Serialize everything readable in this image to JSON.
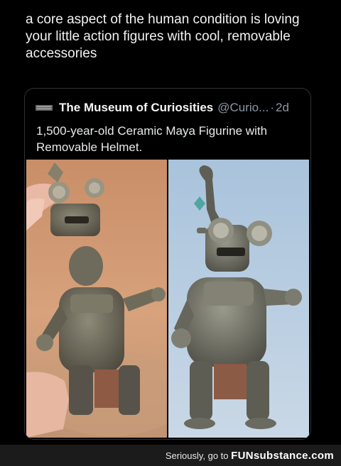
{
  "post": {
    "caption": "a core aspect of the human condition is loving your little action figures with cool, removable accessories"
  },
  "quote": {
    "author_name": "The Museum of Curiosities",
    "author_handle": "@Curio...",
    "separator": "·",
    "time": "2d",
    "text": "1,500-year-old Ceramic Maya Figurine with Removable Helmet.",
    "avatar_icon": "museum-logo-icon"
  },
  "footer": {
    "text": "Seriously, go to",
    "brand_part1": "FUN",
    "brand_part2": "substance",
    "brand_part3": ".com"
  },
  "colors": {
    "background": "#000000",
    "card_border": "#2f3336",
    "muted_text": "#8b98a5",
    "footer_bg": "#1b1b1b"
  }
}
